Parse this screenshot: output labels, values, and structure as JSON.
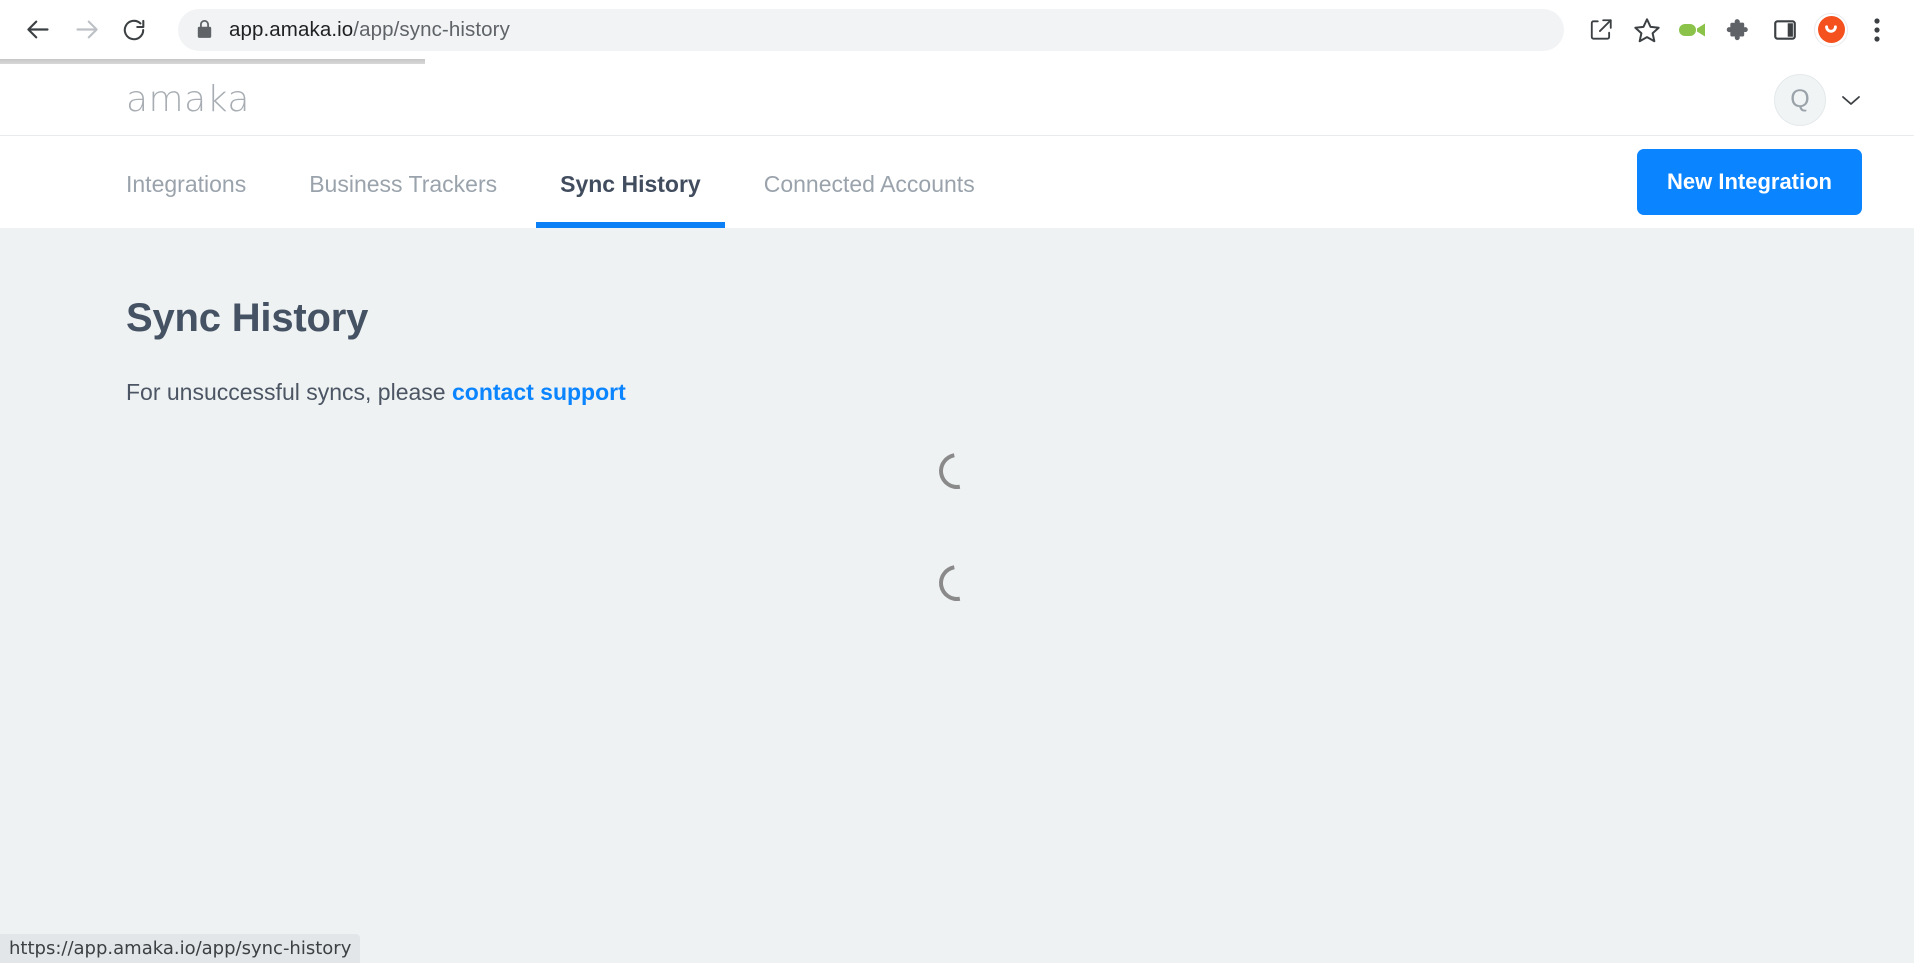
{
  "browser": {
    "back_icon": "arrow-left-icon",
    "forward_icon": "arrow-right-icon",
    "reload_icon": "reload-icon",
    "lock_icon": "lock-icon",
    "url_host": "app.amaka.io",
    "url_path": "/app/sync-history",
    "share_icon": "share-icon",
    "bookmark_icon": "star-icon",
    "camera_icon": "video-camera-icon",
    "extensions_icon": "puzzle-piece-icon",
    "side_panel_icon": "side-panel-icon",
    "profile_icon": "profile-avatar-icon",
    "menu_icon": "three-dot-menu-icon",
    "loading_progress_percent": 22
  },
  "app": {
    "brand": "amaka",
    "account": {
      "initial": "Q",
      "chevron_icon": "chevron-down-icon"
    },
    "tabs": [
      {
        "label": "Integrations",
        "active": false
      },
      {
        "label": "Business Trackers",
        "active": false
      },
      {
        "label": "Sync History",
        "active": true
      },
      {
        "label": "Connected Accounts",
        "active": false
      }
    ],
    "primary_action": "New Integration"
  },
  "main": {
    "title": "Sync History",
    "subtitle_prefix": "For unsuccessful syncs, please ",
    "subtitle_link": "contact support",
    "loading": true,
    "spinner_count": 2
  },
  "status_bar": {
    "url": "https://app.amaka.io/app/sync-history"
  },
  "colors": {
    "accent_blue": "#0a84ff",
    "tab_underline": "#0b7ff5",
    "page_bg": "#eff2f3",
    "title_text": "#455263",
    "muted_text": "#9aa3ac",
    "extension_orange": "#f4511e",
    "extension_green": "#8bc34a"
  }
}
